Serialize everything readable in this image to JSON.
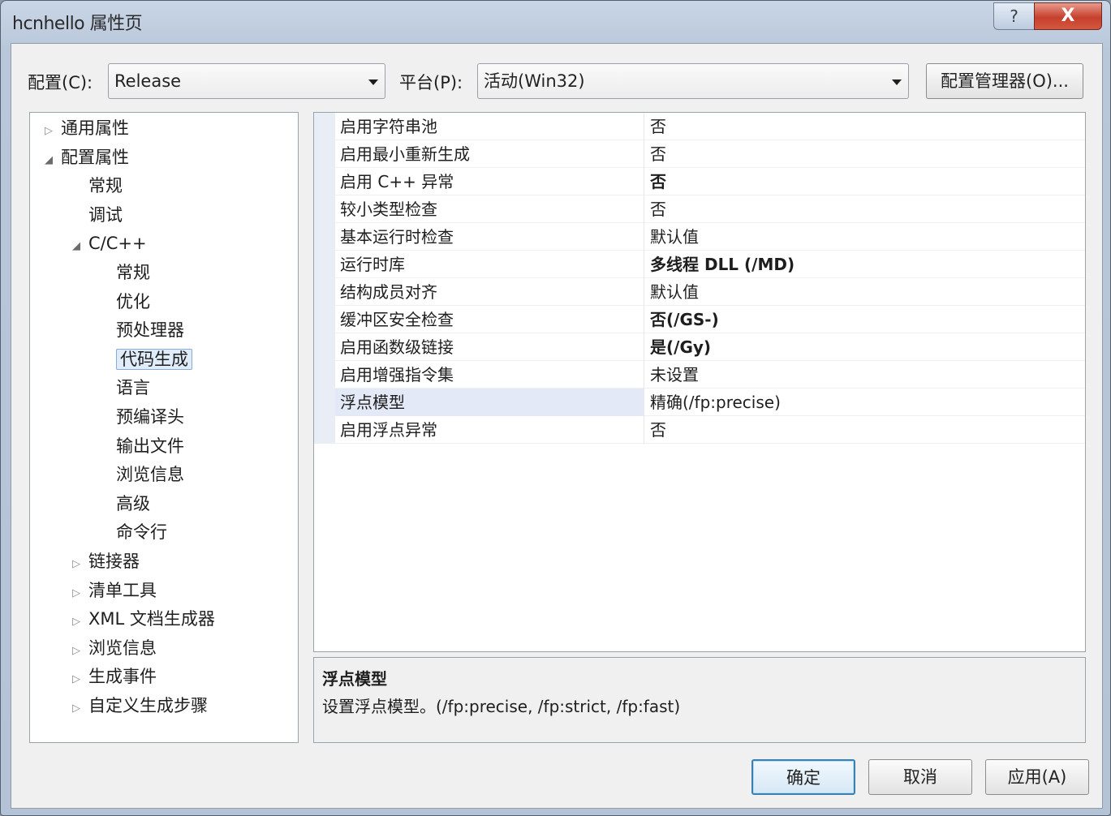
{
  "window": {
    "title": "hcnhello 属性页",
    "help_label": "?",
    "close_label": "X"
  },
  "toolbar": {
    "config_label": "配置(C):",
    "config_value": "Release",
    "platform_label": "平台(P):",
    "platform_value": "活动(Win32)",
    "config_manager_label": "配置管理器(O)..."
  },
  "tree": [
    {
      "label": "通用属性",
      "level": 0,
      "expander": "collapsed"
    },
    {
      "label": "配置属性",
      "level": 0,
      "expander": "expanded"
    },
    {
      "label": "常规",
      "level": 1,
      "expander": "none"
    },
    {
      "label": "调试",
      "level": 1,
      "expander": "none"
    },
    {
      "label": "C/C++",
      "level": 1,
      "expander": "expanded"
    },
    {
      "label": "常规",
      "level": 2,
      "expander": "none"
    },
    {
      "label": "优化",
      "level": 2,
      "expander": "none"
    },
    {
      "label": "预处理器",
      "level": 2,
      "expander": "none"
    },
    {
      "label": "代码生成",
      "level": 2,
      "expander": "none",
      "selected": true
    },
    {
      "label": "语言",
      "level": 2,
      "expander": "none"
    },
    {
      "label": "预编译头",
      "level": 2,
      "expander": "none"
    },
    {
      "label": "输出文件",
      "level": 2,
      "expander": "none"
    },
    {
      "label": "浏览信息",
      "level": 2,
      "expander": "none"
    },
    {
      "label": "高级",
      "level": 2,
      "expander": "none"
    },
    {
      "label": "命令行",
      "level": 2,
      "expander": "none"
    },
    {
      "label": "链接器",
      "level": 1,
      "expander": "collapsed"
    },
    {
      "label": "清单工具",
      "level": 1,
      "expander": "collapsed"
    },
    {
      "label": "XML 文档生成器",
      "level": 1,
      "expander": "collapsed"
    },
    {
      "label": "浏览信息",
      "level": 1,
      "expander": "collapsed"
    },
    {
      "label": "生成事件",
      "level": 1,
      "expander": "collapsed"
    },
    {
      "label": "自定义生成步骤",
      "level": 1,
      "expander": "collapsed"
    }
  ],
  "properties": [
    {
      "name": "启用字符串池",
      "value": "否",
      "bold": false
    },
    {
      "name": "启用最小重新生成",
      "value": "否",
      "bold": false
    },
    {
      "name": "启用 C++ 异常",
      "value": "否",
      "bold": true
    },
    {
      "name": "较小类型检查",
      "value": "否",
      "bold": false
    },
    {
      "name": "基本运行时检查",
      "value": "默认值",
      "bold": false
    },
    {
      "name": "运行时库",
      "value": "多线程 DLL (/MD)",
      "bold": true
    },
    {
      "name": "结构成员对齐",
      "value": "默认值",
      "bold": false
    },
    {
      "name": "缓冲区安全检查",
      "value": "否(/GS-)",
      "bold": true
    },
    {
      "name": "启用函数级链接",
      "value": "是(/Gy)",
      "bold": true
    },
    {
      "name": "启用增强指令集",
      "value": "未设置",
      "bold": false
    },
    {
      "name": "浮点模型",
      "value": "精确(/fp:precise)",
      "bold": false,
      "selected": true
    },
    {
      "name": "启用浮点异常",
      "value": "否",
      "bold": false
    }
  ],
  "description": {
    "title": "浮点模型",
    "text": "设置浮点模型。(/fp:precise, /fp:strict, /fp:fast)"
  },
  "buttons": {
    "ok": "确定",
    "cancel": "取消",
    "apply": "应用(A)"
  }
}
